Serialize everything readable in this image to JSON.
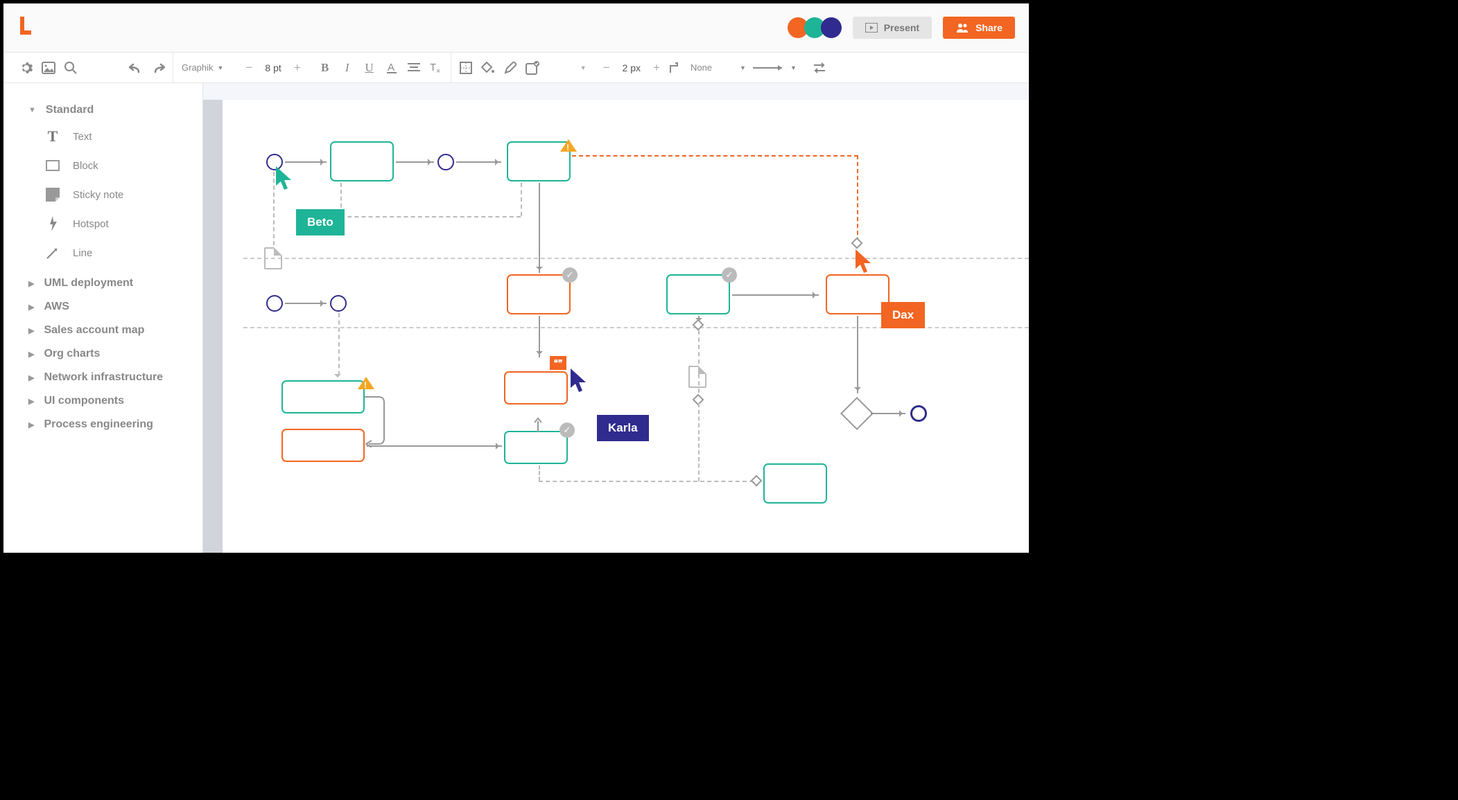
{
  "header": {
    "present_label": "Present",
    "share_label": "Share"
  },
  "toolbar": {
    "font_family": "Graphik",
    "font_size": "8 pt",
    "stroke_width": "2 px",
    "line_cap": "None"
  },
  "sidebar": {
    "sections": [
      {
        "label": "Standard",
        "expanded": true,
        "items": [
          {
            "label": "Text"
          },
          {
            "label": "Block"
          },
          {
            "label": "Sticky note"
          },
          {
            "label": "Hotspot"
          },
          {
            "label": "Line"
          }
        ]
      },
      {
        "label": "UML deployment",
        "expanded": false
      },
      {
        "label": "AWS",
        "expanded": false
      },
      {
        "label": "Sales account map",
        "expanded": false
      },
      {
        "label": "Org charts",
        "expanded": false
      },
      {
        "label": "Network infrastructure",
        "expanded": false
      },
      {
        "label": "UI components",
        "expanded": false
      },
      {
        "label": "Process engineering",
        "expanded": false
      }
    ]
  },
  "collaborators": {
    "beto": "Beto",
    "karla": "Karla",
    "dax": "Dax"
  }
}
